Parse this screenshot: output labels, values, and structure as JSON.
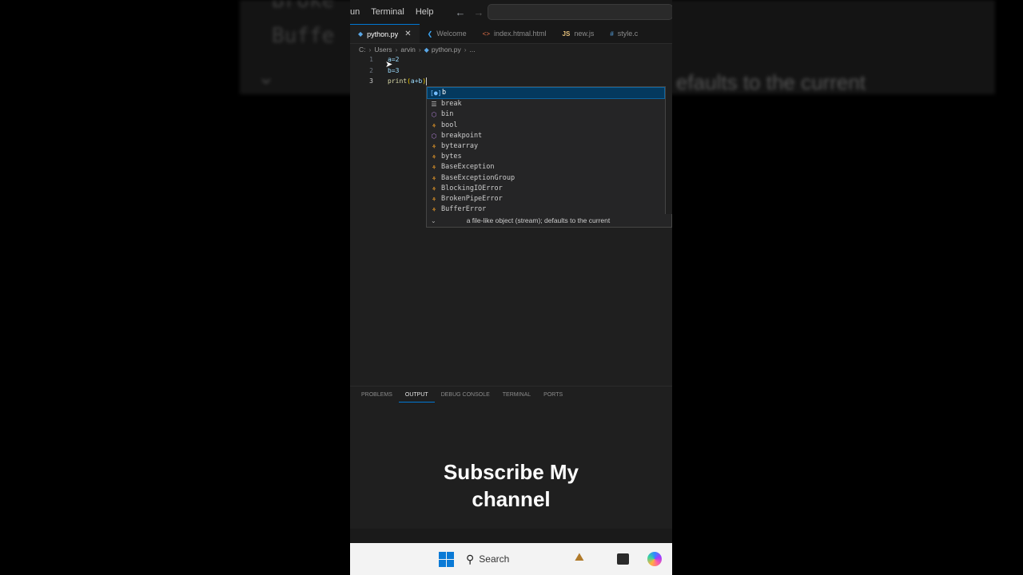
{
  "background": {
    "blur_items": [
      "Broke",
      "Buffe",
      "efaults to the current"
    ]
  },
  "menubar": {
    "items": [
      "un",
      "Terminal",
      "Help"
    ]
  },
  "tabs": [
    {
      "label": "python.py",
      "icon": "python-icon",
      "active": true
    },
    {
      "label": "Welcome",
      "icon": "vscode-icon",
      "active": false
    },
    {
      "label": "index.htmal.html",
      "icon": "html-icon",
      "active": false
    },
    {
      "label": "new.js",
      "icon": "js-icon",
      "active": false
    },
    {
      "label": "style.c",
      "icon": "css-icon",
      "active": false
    }
  ],
  "breadcrumb": [
    "C:",
    "Users",
    "arvin",
    "python.py",
    "..."
  ],
  "editor": {
    "lines": [
      {
        "num": "1",
        "text": "a=2"
      },
      {
        "num": "2",
        "text": "b=3"
      },
      {
        "num": "3",
        "fn": "print",
        "open": "(",
        "args": "a+b",
        "close": ")"
      }
    ]
  },
  "suggestions": [
    {
      "label": "b",
      "kind": "variable",
      "selected": true
    },
    {
      "label": "break",
      "kind": "keyword"
    },
    {
      "label": "bin",
      "kind": "function"
    },
    {
      "label": "bool",
      "kind": "class"
    },
    {
      "label": "breakpoint",
      "kind": "function"
    },
    {
      "label": "bytearray",
      "kind": "class"
    },
    {
      "label": "bytes",
      "kind": "class"
    },
    {
      "label": "BaseException",
      "kind": "class"
    },
    {
      "label": "BaseExceptionGroup",
      "kind": "class"
    },
    {
      "label": "BlockingIOError",
      "kind": "class"
    },
    {
      "label": "BrokenPipeError",
      "kind": "class"
    },
    {
      "label": "BufferError",
      "kind": "class"
    }
  ],
  "tooltip": "a file-like object (stream); defaults to the current",
  "panel_tabs": [
    {
      "label": "PROBLEMS",
      "active": false
    },
    {
      "label": "OUTPUT",
      "active": true
    },
    {
      "label": "DEBUG CONSOLE",
      "active": false
    },
    {
      "label": "TERMINAL",
      "active": false
    },
    {
      "label": "PORTS",
      "active": false
    }
  ],
  "caption": {
    "line1": "Subscribe My",
    "line2": "channel"
  },
  "taskbar": {
    "search_label": "Search"
  },
  "colors": {
    "accent": "#0078d4",
    "selection": "#04395e",
    "editor_bg": "#1f1f1f"
  }
}
